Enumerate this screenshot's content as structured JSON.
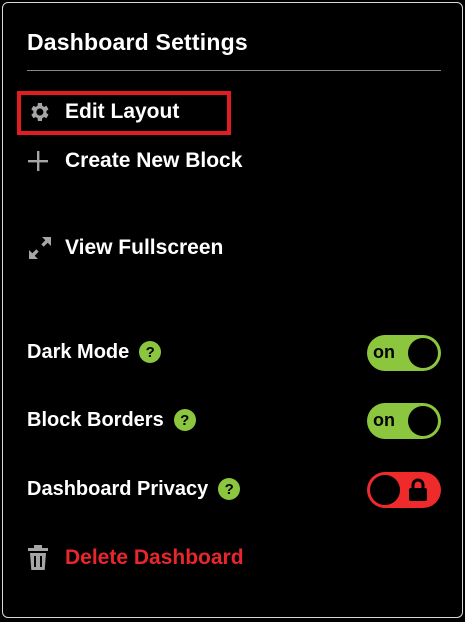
{
  "panel": {
    "title": "Dashboard Settings"
  },
  "menu": {
    "edit_layout": "Edit Layout",
    "create_block": "Create New Block",
    "view_fullscreen": "View Fullscreen",
    "delete_dashboard": "Delete Dashboard"
  },
  "settings": {
    "dark_mode": {
      "label": "Dark Mode",
      "help": "?",
      "state": "on"
    },
    "block_borders": {
      "label": "Block Borders",
      "help": "?",
      "state": "on"
    },
    "dashboard_privacy": {
      "label": "Dashboard Privacy",
      "help": "?",
      "state": "locked"
    }
  },
  "colors": {
    "accent_green": "#8cc63f",
    "danger_red": "#e8262b",
    "highlight_red": "#e21c23"
  },
  "icons": {
    "edit_layout": "gear-icon",
    "create_block": "plus-icon",
    "view_fullscreen": "expand-icon",
    "delete_dashboard": "trash-icon",
    "privacy_toggle": "lock-icon"
  }
}
